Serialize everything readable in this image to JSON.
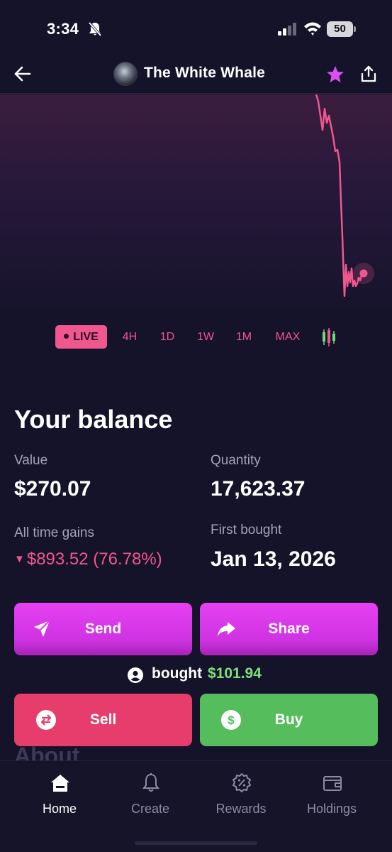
{
  "status_bar": {
    "time": "3:34",
    "battery_level": "50",
    "icons": [
      "bell-slash-icon",
      "signal-icon",
      "wifi-icon",
      "battery-icon"
    ]
  },
  "header": {
    "title": "The White Whale",
    "icons": [
      "back-arrow-icon",
      "coin-avatar",
      "star-icon",
      "share-upload-icon"
    ],
    "star_color": "#d94ff0"
  },
  "chart": {
    "line_color": "#f0578f",
    "live_point": true
  },
  "timeframes": {
    "items": [
      "LIVE",
      "4H",
      "1D",
      "1W",
      "1M",
      "MAX"
    ],
    "selected": "LIVE",
    "chart_toggle_icon": "candlestick-icon"
  },
  "balance": {
    "title": "Your balance",
    "value_label": "Value",
    "value": "$270.07",
    "quantity_label": "Quantity",
    "quantity": "17,623.37",
    "gains_label": "All time gains",
    "gains_value": "$893.52 (76.78%)",
    "first_bought_label": "First bought",
    "first_bought": "Jan 13, 2026"
  },
  "actions": {
    "send_label": "Send",
    "share_label": "Share",
    "sell_label": "Sell",
    "buy_label": "Buy",
    "colors": {
      "send": "#dc3ced",
      "share": "#dc3ced",
      "sell": "#e63d6c",
      "buy": "#55bd5b"
    }
  },
  "activity": {
    "bought_text": "bought",
    "bought_amount": "$101.94"
  },
  "about_peek": "About",
  "bottom_nav": {
    "items": [
      {
        "label": "Home",
        "icon": "home-icon",
        "active": true
      },
      {
        "label": "Create",
        "icon": "bell-icon",
        "active": false
      },
      {
        "label": "Rewards",
        "icon": "percent-badge-icon",
        "active": false
      },
      {
        "label": "Holdings",
        "icon": "wallet-icon",
        "active": false
      }
    ]
  }
}
